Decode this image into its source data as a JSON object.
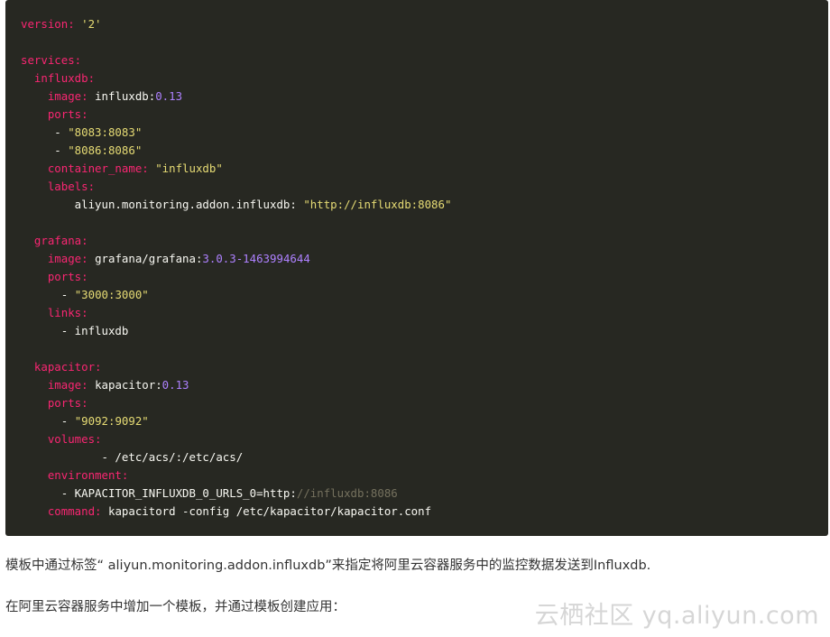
{
  "code": {
    "lines": [
      [
        {
          "t": "version: ",
          "c": "k"
        },
        {
          "t": "'2'",
          "c": "s"
        }
      ],
      [],
      [
        {
          "t": "services:",
          "c": "k"
        }
      ],
      [
        {
          "t": "  influxdb:",
          "c": "k"
        }
      ],
      [
        {
          "t": "    image: ",
          "c": "k"
        },
        {
          "t": "influxdb:",
          "c": "t"
        },
        {
          "t": "0.13",
          "c": "n"
        }
      ],
      [
        {
          "t": "    ports:",
          "c": "k"
        }
      ],
      [
        {
          "t": "     - ",
          "c": "t"
        },
        {
          "t": "\"8083:8083\"",
          "c": "s"
        }
      ],
      [
        {
          "t": "     - ",
          "c": "t"
        },
        {
          "t": "\"8086:8086\"",
          "c": "s"
        }
      ],
      [
        {
          "t": "    container_name: ",
          "c": "k"
        },
        {
          "t": "\"influxdb\"",
          "c": "s"
        }
      ],
      [
        {
          "t": "    labels:",
          "c": "k"
        }
      ],
      [
        {
          "t": "        aliyun.monitoring.addon.influxdb: ",
          "c": "t"
        },
        {
          "t": "\"http://influxdb:8086\"",
          "c": "s"
        }
      ],
      [],
      [
        {
          "t": "  grafana:",
          "c": "k"
        }
      ],
      [
        {
          "t": "    image: ",
          "c": "k"
        },
        {
          "t": "grafana/grafana:",
          "c": "t"
        },
        {
          "t": "3.0.3-1463994644",
          "c": "n"
        }
      ],
      [
        {
          "t": "    ports:",
          "c": "k"
        }
      ],
      [
        {
          "t": "      - ",
          "c": "t"
        },
        {
          "t": "\"3000:3000\"",
          "c": "s"
        }
      ],
      [
        {
          "t": "    links:",
          "c": "k"
        }
      ],
      [
        {
          "t": "      - influxdb",
          "c": "t"
        }
      ],
      [],
      [
        {
          "t": "  kapacitor:",
          "c": "k"
        }
      ],
      [
        {
          "t": "    image: ",
          "c": "k"
        },
        {
          "t": "kapacitor:",
          "c": "t"
        },
        {
          "t": "0.13",
          "c": "n"
        }
      ],
      [
        {
          "t": "    ports:",
          "c": "k"
        }
      ],
      [
        {
          "t": "      - ",
          "c": "t"
        },
        {
          "t": "\"9092:9092\"",
          "c": "s"
        }
      ],
      [
        {
          "t": "    volumes:",
          "c": "k"
        }
      ],
      [
        {
          "t": "            - /etc/acs/:/etc/acs/",
          "c": "t"
        }
      ],
      [
        {
          "t": "    environment:",
          "c": "k"
        }
      ],
      [
        {
          "t": "      - KAPACITOR_INFLUXDB_0_URLS_0=http:",
          "c": "t"
        },
        {
          "t": "//influxdb:8086",
          "c": "c"
        }
      ],
      [
        {
          "t": "    command: ",
          "c": "k"
        },
        {
          "t": "kapacitord -config /etc/kapacitor/kapacitor.conf",
          "c": "t"
        }
      ]
    ]
  },
  "paragraph1": "模板中通过标签“ aliyun.monitoring.addon.influxdb”来指定将阿里云容器服务中的监控数据发送到Influxdb.",
  "paragraph2": "在阿里云容器服务中增加一个模板，并通过模板创建应用：",
  "watermark": "云栖社区 yq.aliyun.com",
  "colors": {
    "code_bg": "#272822",
    "key": "#f92672",
    "string": "#e6db74",
    "number": "#ae81ff",
    "comment": "#75715e",
    "text": "#f8f8f2"
  }
}
